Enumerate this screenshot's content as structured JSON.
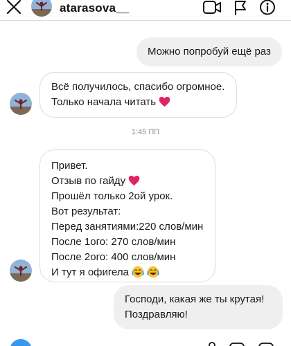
{
  "header": {
    "username": "atarasova__",
    "icons": [
      "close-icon",
      "avatar",
      "video-call-icon",
      "flag-icon",
      "info-icon"
    ]
  },
  "messages": [
    {
      "from": "me",
      "lines": [
        "Можно попробуй ещё раз"
      ]
    },
    {
      "from": "them",
      "lines": [
        "Всё получилось, спасибо огромное.",
        "Только начала читать"
      ],
      "emoji_after": "red-heart"
    },
    {
      "from": "them",
      "lines": [
        "Привет.",
        "Отзыв по гайду",
        "Прошёл только 2ой урок.",
        "Вот результат:",
        "Перед занятиями:220 слов/мин",
        "После 1ого: 270 слов/мин",
        "После 2ого: 400 слов/мин",
        "И тут я офигела"
      ]
    },
    {
      "from": "me",
      "lines": [
        "Господи, какая же ты крутая!",
        "Поздравляю!"
      ]
    }
  ],
  "timestamp": "1:45 ПП",
  "composer": {
    "icons": [
      "camera-icon",
      "microphone-icon",
      "gallery-icon",
      "sticker-icon"
    ]
  },
  "colors": {
    "outgoing_bubble": "#efefef",
    "incoming_border": "#dbdbdb",
    "timestamp": "#8e8e8e",
    "camera_button": "#3797f0",
    "heart": "#e0245e"
  }
}
